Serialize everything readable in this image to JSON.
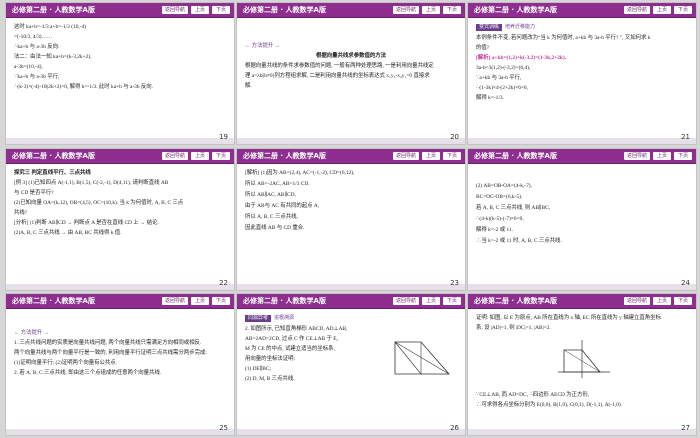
{
  "header": {
    "title": "必修第二册 · 人教数学A版",
    "nav_label": "返回导航",
    "prev_label": "上页",
    "next_label": "下页"
  },
  "slides": [
    {
      "page": "19",
      "lines": [
        "这时 ka+b=-1/3 a+b=-1/3 (10,-4)",
        "=(-10/3, 4/3)……",
        "∴ka+b 与 a-3b 反向.",
        "法二：由法一知 ka+b=(k-3,2k+2),",
        "a-3b=(10,-4),",
        "∵ka+b 与 a-3b 平行,",
        "∴(k-3)×(-4)-10(2k+2)=0, 解得 k=-1/3. 此时 ka+b 与 a-3b 反向."
      ]
    },
    {
      "page": "20",
      "tag": "← 方法提升 →",
      "lines": [
        "根据向量共线求参数值的方法",
        "根据向量共线的条件求参数值的问题, 一般有两种处理思路, 一是利用向量共线定",
        "理 a=λb(b≠0)列方程组求解, 二是利用向量共线的坐标表达式 x₁y₂-x₂y₁=0 直接求",
        "解."
      ]
    },
    {
      "page": "21",
      "badge": "变式训练",
      "badge_sub": "培养迁移能力",
      "lines": [
        "本例条件不变, 若问题改为“当 k 为何值时, a+kb 与 3a-b 平行? ”, 又如何求 k",
        "的值?",
        "[解析] a+kb=(1,2)+k(-3,2)=(1-3k,2+2k),",
        "3a-b=3(1,2)-(-3,2)=(6,4),",
        "∵a+kb 与 3a-b 平行,",
        "∴(1-3k)×4-(2+2k)×6=0,",
        "解得 k=-1/3."
      ]
    },
    {
      "page": "22",
      "lines": [
        "探究三   判定直线平行、三点共线",
        "[例 3] (1)已知四点 A(-1,1), B(1,5), C(-2,-1), D(4,11), 请判断直线 AB",
        "与 CD 是否平行?",
        "(2)已知向量 OA=(k,12), OB=(4,5), OC=(10,k). 当 k 为何值时, A, B, C 三点",
        "共线?",
        "[分析] (1)判断 AB∥CD → 判断点 A 是否在直线 CD 上 → 结论.",
        "(2)A, B, C 三点共线 → 由 AB, BC 共线得 k 值."
      ]
    },
    {
      "page": "23",
      "lines": [
        "[解析] (1)因为 AB=(2,4), AC=(-1,-2), CD=(6,12),",
        "所以 AB=-2AC, AB=1/3 CD.",
        "所以 AB∥AC, AB∥CD,",
        "由于 AB与 AC 有共同的起点 A,",
        "所以 A, B, C 三点共线,",
        "因此直线 AB 与 CD 重合."
      ]
    },
    {
      "page": "24",
      "lines": [
        "(2) AB=OB-OA=(4-k,-7),",
        "BC=OC-OB=(6,k-5).",
        "若 A, B, C 三点共线, 则 AB∥BC,",
        "∴(4-k)(k-5)-(-7)×6=0,",
        "解得 k=-2 或 11.",
        "∴当 k=-2 或 11 时, A, B, C 三点共线."
      ]
    },
    {
      "page": "25",
      "tag": "← 方法提升 →",
      "lines": [
        "1. 三点共线问题的实质是向量共线问题, 两个向量共线只需满足方向相同或相反.",
        "两个向量共线与两个向量平行是一致的, 利用向量平行证明三点共线需分两步完成:",
        "(1)证明向量平行; (2)证明两个向量有公共点.",
        "2. 若 A, B, C 三点共线, 即由这三个点组成的任意两个向量共线."
      ]
    },
    {
      "page": "26",
      "badge": "同源异考",
      "badge_sub": "追根溯源",
      "lines": [
        "2. 如图所示, 已知直角梯形 ABCD, AD⊥AB,",
        "AB=2AD=2CD, 过点 C 作 CE⊥AB 于 E,",
        "M 为 CE 的中点, 试建立适当的坐标系,",
        "用向量的坐标法证明:",
        "(1) DE∥BC;",
        "(2) D, M, B 三点共线."
      ]
    },
    {
      "page": "27",
      "lines": [
        "证明: 如图, 以 E 为原点, AB 所在直线为 x 轴, EC 所在直线为 y 轴建立直角坐标",
        "系, 设 |AD|=1, 则 |DC|=1, |AB|=2.",
        "∵CE⊥AB, 而 AD=DC, ∴四边形 AECD 为正方形,",
        "∴可求得各点坐标分别为 E(0,0), B(1,0), C(0,1), D(-1,1), A(-1,0)."
      ]
    }
  ]
}
